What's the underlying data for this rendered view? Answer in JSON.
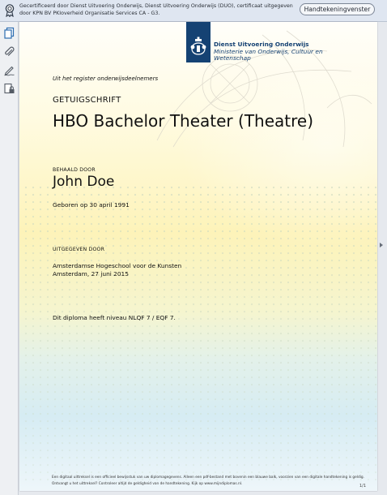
{
  "banner": {
    "icon": "ribbon-certificate-icon",
    "message": "Gecertificeerd door Dienst Uitvoering Onderwijs, Dienst Uitvoering Onderwijs (DUO), certificaat uitgegeven door KPN BV PKIoverheid Organisatie Services CA - G3.",
    "signature_button": "Handtekeningvenster"
  },
  "sidebar": {
    "items": [
      {
        "name": "page-thumbnails",
        "icon": "pages-icon"
      },
      {
        "name": "attachments",
        "icon": "paperclip-icon"
      },
      {
        "name": "signatures",
        "icon": "signature-pen-icon"
      },
      {
        "name": "security",
        "icon": "lock-document-icon"
      }
    ]
  },
  "document": {
    "issuer": {
      "line1": "Dienst Uitvoering Onderwijs",
      "line2": "Ministerie van Onderwijs, Cultuur en",
      "line3": "Wetenschap"
    },
    "registry": "Uit het register onderwijsdeelnemers",
    "doc_type": "GETUIGSCHRIFT",
    "degree": "HBO Bachelor Theater (Theatre)",
    "holder_label": "BEHAALD DOOR",
    "holder_name": "John Doe",
    "birth_line": "Geboren op 30 april 1991",
    "issued_label": "UITGEGEVEN DOOR",
    "institution": "Amsterdamse Hogeschool voor de Kunsten",
    "place_date": "Amsterdam, 27 juni 2015",
    "level_note": "Dit diploma heeft niveau NLQF 7 / EQF 7.",
    "footer_line1": "Een digitaal uittreksel is een officieel bewijsstuk van uw diplomagegevens. Alleen een pdf-bestand met bovenin een blauwe balk, voorzien van een digitale handtekening is geldig.",
    "footer_line2": "Ontvangt u het uittreksel? Controleer altijd de geldigheid van de handtekening. Kijk op www.mijndiplomas.nl.",
    "page_indicator": "1/1"
  },
  "colors": {
    "banner_bg": "#dfe6f1",
    "rijksoverheid_blue": "#154273",
    "icon_blue": "#2b6cb0"
  }
}
